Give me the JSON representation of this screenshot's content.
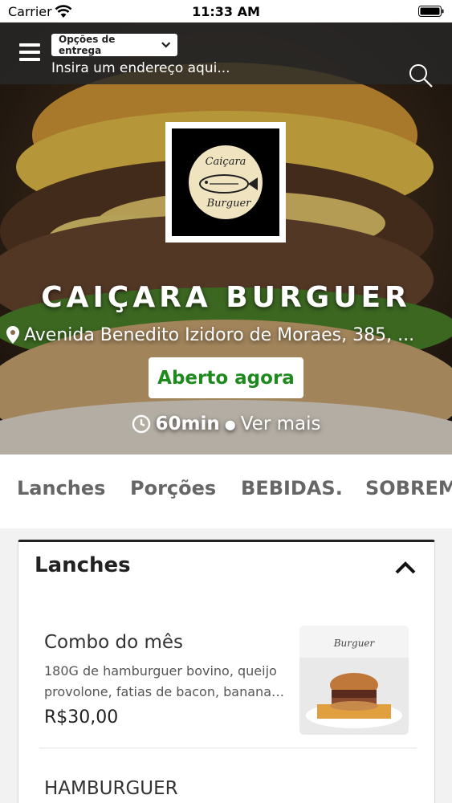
{
  "status_bar": {
    "carrier": "Carrier",
    "time": "11:33 AM"
  },
  "header": {
    "delivery_options_label": "Opções de entrega",
    "address_placeholder": "Insira um endereço aqui..."
  },
  "store": {
    "logo_text_top": "Caiçara",
    "logo_text_bottom": "Burguer",
    "name": "CAIÇARA BURGUER",
    "address": "Avenida Benedito Izidoro de Moraes, 385, ...",
    "status": "Aberto agora",
    "delivery_time": "60min",
    "separator": "●",
    "see_more": "Ver mais"
  },
  "categories": [
    "Lanches",
    "Porções",
    "BEBIDAS.",
    "SOBREMESAS"
  ],
  "section": {
    "title": "Lanches",
    "items": [
      {
        "name": "Combo do mês",
        "description": "180G de hamburguer bovino, queijo provolone, fatias de bacon, banana…",
        "price": "R$30,00",
        "photo_caption": "Burguer"
      },
      {
        "name": "HAMBURGUER"
      }
    ]
  },
  "colors": {
    "open_green": "#1e8a1e",
    "topbar": "#282828"
  }
}
